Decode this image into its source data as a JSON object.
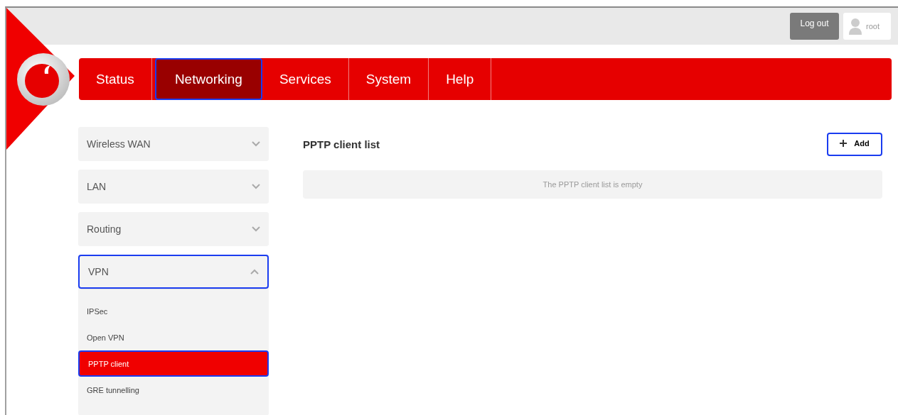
{
  "header": {
    "logout_button": "Log out",
    "user": "root"
  },
  "nav": [
    {
      "label": "Status",
      "selected": false,
      "highlighted": false
    },
    {
      "label": "Networking",
      "selected": true,
      "highlighted": true
    },
    {
      "label": "Services",
      "selected": false,
      "highlighted": false
    },
    {
      "label": "System",
      "selected": false,
      "highlighted": false
    },
    {
      "label": "Help",
      "selected": false,
      "highlighted": false
    }
  ],
  "sidebar": [
    {
      "label": "Wireless WAN",
      "expanded": false,
      "highlighted": false
    },
    {
      "label": "LAN",
      "expanded": false,
      "highlighted": false
    },
    {
      "label": "Routing",
      "expanded": false,
      "highlighted": false
    },
    {
      "label": "VPN",
      "expanded": true,
      "highlighted": true,
      "children": [
        {
          "label": "IPSec",
          "selected": false,
          "highlighted": false
        },
        {
          "label": "Open VPN",
          "selected": false,
          "highlighted": false
        },
        {
          "label": "PPTP client",
          "selected": true,
          "highlighted": true
        },
        {
          "label": "GRE tunnelling",
          "selected": false,
          "highlighted": false
        }
      ]
    }
  ],
  "main": {
    "title": "PPTP client list",
    "add_button": {
      "label": "Add",
      "highlighted": true
    },
    "empty_message": "The PPTP client list is empty"
  }
}
